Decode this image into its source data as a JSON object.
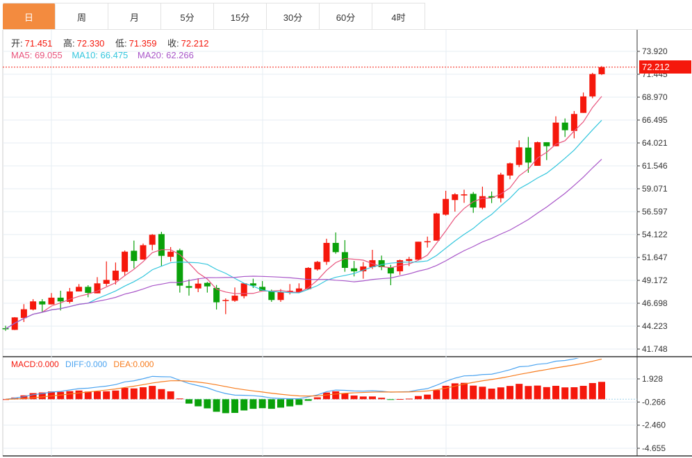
{
  "tabs": [
    {
      "label": "日",
      "active": true
    },
    {
      "label": "周"
    },
    {
      "label": "月"
    },
    {
      "label": "5分"
    },
    {
      "label": "15分"
    },
    {
      "label": "30分"
    },
    {
      "label": "60分"
    },
    {
      "label": "4时"
    }
  ],
  "ohlc_legend": {
    "open_label": "开:",
    "open": "71.451",
    "high_label": "高:",
    "high": "72.330",
    "low_label": "低:",
    "low": "71.359",
    "close_label": "收:",
    "close": "72.212"
  },
  "ma_legend": {
    "ma5": "MA5: 69.055",
    "ma10": "MA10: 66.475",
    "ma20": "MA20: 62.266"
  },
  "last_price_tag": "72.212",
  "macd_legend": {
    "macd": "MACD:0.000",
    "diff": "DIFF:0.000",
    "dea": "DEA:0.000"
  },
  "colors": {
    "up": "#f5180c",
    "down": "#0aa10a",
    "ma5": "#e8537c",
    "ma10": "#33c6dd",
    "ma20": "#a855c8",
    "diff": "#4aa3f0",
    "dea": "#f77b1c",
    "active_tab": "#f38b3f"
  },
  "chart_data": {
    "type": "candlestick",
    "price_axis_labels": [
      "73.920",
      "71.445",
      "68.970",
      "66.495",
      "64.021",
      "61.546",
      "59.071",
      "56.597",
      "54.122",
      "51.647",
      "49.172",
      "46.698",
      "44.223",
      "41.748"
    ],
    "price_range": [
      41.748,
      73.92
    ],
    "macd_axis_labels": [
      "1.928",
      "-0.266",
      "-2.460",
      "-4.655"
    ],
    "macd_range": [
      -4.655,
      1.928
    ],
    "candles_ohlc": [
      [
        44.0,
        44.27,
        43.72,
        43.92
      ],
      [
        43.82,
        45.2,
        43.8,
        45.17
      ],
      [
        45.1,
        46.6,
        44.67,
        46.05
      ],
      [
        46.02,
        47.14,
        45.92,
        46.9
      ],
      [
        46.9,
        47.14,
        45.77,
        46.57
      ],
      [
        46.57,
        47.8,
        46.57,
        47.3
      ],
      [
        47.3,
        48.05,
        45.92,
        46.9
      ],
      [
        46.85,
        48.35,
        46.67,
        47.97
      ],
      [
        47.97,
        48.77,
        47.97,
        48.47
      ],
      [
        48.47,
        48.65,
        47.35,
        47.82
      ],
      [
        47.77,
        49.52,
        47.77,
        48.85
      ],
      [
        48.8,
        51.22,
        48.55,
        49.22
      ],
      [
        49.17,
        51.1,
        48.72,
        50.22
      ],
      [
        50.1,
        52.4,
        49.72,
        52.27
      ],
      [
        52.37,
        53.47,
        50.47,
        51.27
      ],
      [
        51.42,
        53.15,
        51.42,
        52.97
      ],
      [
        53.02,
        54.17,
        52.42,
        54.1
      ],
      [
        54.17,
        54.42,
        50.67,
        51.82
      ],
      [
        51.72,
        52.77,
        51.22,
        52.27
      ],
      [
        52.42,
        52.6,
        47.85,
        48.6
      ],
      [
        48.55,
        49.27,
        47.52,
        48.37
      ],
      [
        48.3,
        49.4,
        47.9,
        48.82
      ],
      [
        48.9,
        49.0,
        47.85,
        48.52
      ],
      [
        48.35,
        48.67,
        46.02,
        46.8
      ],
      [
        46.97,
        47.22,
        45.52,
        47.05
      ],
      [
        46.97,
        48.4,
        46.85,
        47.52
      ],
      [
        47.47,
        48.85,
        47.22,
        48.85
      ],
      [
        48.85,
        49.35,
        48.35,
        48.6
      ],
      [
        48.47,
        49.1,
        48.05,
        48.05
      ],
      [
        48.02,
        48.17,
        46.85,
        47.05
      ],
      [
        47.05,
        48.22,
        46.85,
        47.9
      ],
      [
        47.97,
        48.77,
        47.65,
        48.05
      ],
      [
        47.9,
        48.85,
        47.9,
        48.3
      ],
      [
        48.22,
        50.6,
        48.22,
        50.52
      ],
      [
        50.35,
        51.27,
        50.22,
        51.17
      ],
      [
        51.17,
        53.67,
        50.85,
        53.22
      ],
      [
        53.22,
        54.35,
        52.05,
        52.22
      ],
      [
        52.22,
        53.52,
        50.1,
        50.52
      ],
      [
        50.47,
        51.27,
        49.6,
        50.15
      ],
      [
        50.15,
        51.15,
        49.35,
        50.67
      ],
      [
        50.6,
        52.47,
        50.4,
        51.35
      ],
      [
        51.35,
        51.85,
        50.27,
        50.6
      ],
      [
        50.55,
        50.85,
        48.65,
        49.92
      ],
      [
        50.15,
        51.42,
        49.77,
        51.35
      ],
      [
        51.27,
        51.72,
        50.72,
        51.47
      ],
      [
        51.4,
        53.35,
        51.4,
        53.35
      ],
      [
        53.35,
        53.9,
        52.72,
        53.4
      ],
      [
        53.47,
        56.47,
        53.47,
        56.4
      ],
      [
        56.27,
        58.85,
        56.17,
        57.97
      ],
      [
        57.85,
        58.6,
        56.6,
        58.47
      ],
      [
        58.35,
        58.97,
        57.55,
        58.47
      ],
      [
        58.52,
        58.72,
        56.47,
        57.05
      ],
      [
        57.02,
        59.3,
        56.85,
        58.27
      ],
      [
        58.27,
        58.77,
        57.52,
        58.1
      ],
      [
        58.05,
        60.8,
        57.6,
        60.6
      ],
      [
        60.5,
        61.9,
        60.1,
        61.82
      ],
      [
        61.65,
        64.3,
        61.42,
        63.55
      ],
      [
        63.52,
        64.67,
        60.8,
        61.9
      ],
      [
        61.55,
        64.17,
        61.55,
        64.1
      ],
      [
        64.1,
        64.1,
        62.17,
        63.67
      ],
      [
        63.67,
        66.9,
        63.67,
        66.22
      ],
      [
        66.22,
        66.67,
        64.67,
        65.4
      ],
      [
        65.32,
        67.47,
        64.52,
        67.15
      ],
      [
        67.27,
        69.47,
        67.27,
        69.05
      ],
      [
        69.05,
        71.6,
        68.85,
        71.47
      ],
      [
        71.451,
        72.33,
        71.359,
        72.212
      ]
    ],
    "moving_averages": [
      5,
      10,
      20
    ],
    "indicator": "MACD",
    "grid": true
  }
}
